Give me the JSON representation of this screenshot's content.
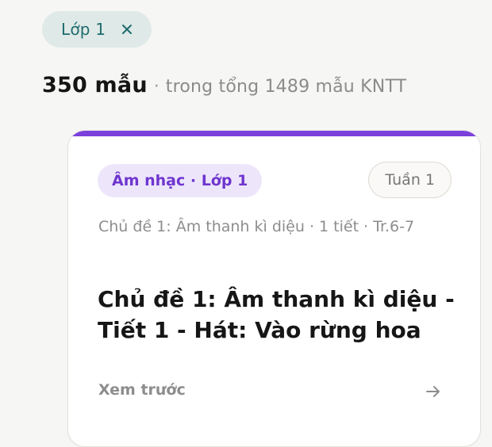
{
  "filter": {
    "chip_label": "Lớp 1",
    "close_icon": "close-icon"
  },
  "summary": {
    "count_text": "350 mẫu",
    "separator": "·",
    "total_text": "trong tổng 1489 mẫu KNTT"
  },
  "card": {
    "accent_color": "#7b3fdc",
    "subject_badge": "Âm nhạc · Lớp 1",
    "week_badge": "Tuần 1",
    "meta": "Chủ đề 1: Âm thanh kì diệu · 1 tiết · Tr.6-7",
    "title": "Chủ đề 1: Âm thanh kì diệu - Tiết 1 - Hát: Vào rừng hoa",
    "preview_label": "Xem trước",
    "arrow_icon": "arrow-right-icon"
  }
}
